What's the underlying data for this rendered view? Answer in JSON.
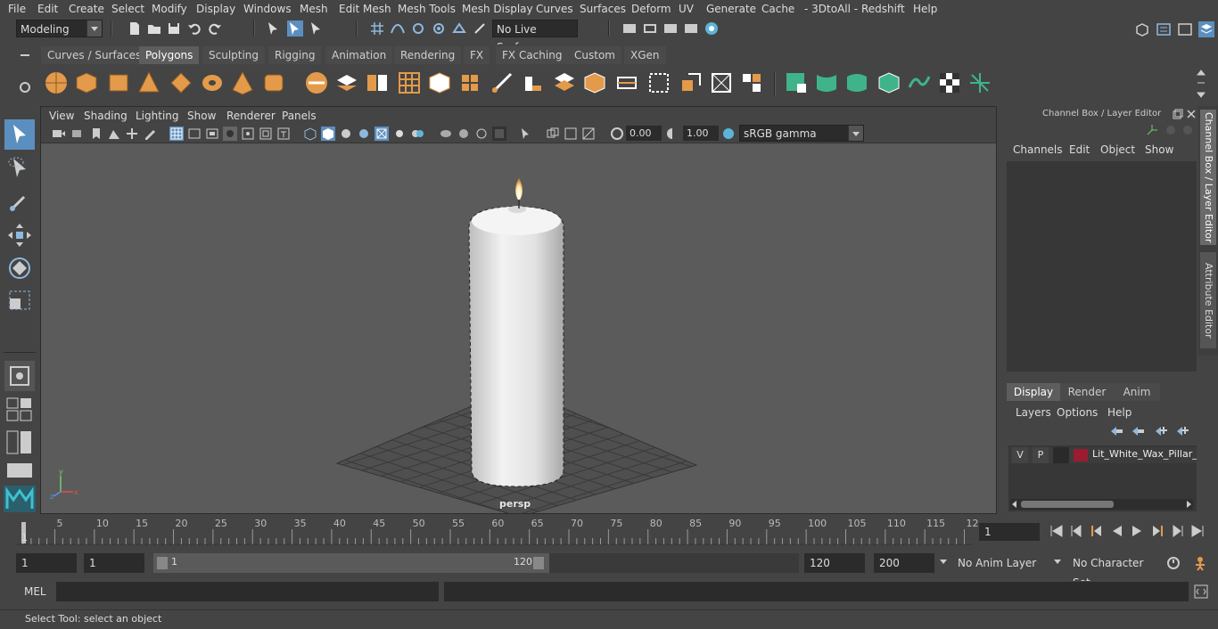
{
  "menu": [
    "File",
    "Edit",
    "Create",
    "Select",
    "Modify",
    "Display",
    "Windows",
    "Mesh",
    "Edit Mesh",
    "Mesh Tools",
    "Mesh Display",
    "Curves",
    "Surfaces",
    "Deform",
    "UV",
    "Generate",
    "Cache",
    "- 3DtoAll -",
    "Redshift",
    "Help"
  ],
  "status": {
    "workspace": "Modeling",
    "live_surface": "No Live Surface"
  },
  "shelf_tabs": [
    "Curves / Surfaces",
    "Polygons",
    "Sculpting",
    "Rigging",
    "Animation",
    "Rendering",
    "FX",
    "FX Caching",
    "Custom",
    "XGen"
  ],
  "active_shelf_tab": "Polygons",
  "viewport": {
    "menu": [
      "View",
      "Shading",
      "Lighting",
      "Show",
      "Renderer",
      "Panels"
    ],
    "exposure": "0.00",
    "gamma": "1.00",
    "color_space": "sRGB gamma",
    "camera_label": "persp"
  },
  "channel_box": {
    "title": "Channel Box / Layer Editor",
    "menu": [
      "Channels",
      "Edit",
      "Object",
      "Show"
    ]
  },
  "layer_editor": {
    "tabs": [
      "Display",
      "Render",
      "Anim"
    ],
    "active_tab": "Display",
    "menu": [
      "Layers",
      "Options",
      "Help"
    ],
    "layer": {
      "v": "V",
      "p": "P",
      "name": "Lit_White_Wax_Pillar_C",
      "color": "#9b1b30"
    }
  },
  "side_tabs": [
    "Channel Box / Layer Editor",
    "Attribute Editor"
  ],
  "timeline": {
    "ticks": [
      "5",
      "10",
      "15",
      "20",
      "25",
      "30",
      "35",
      "40",
      "45",
      "50",
      "55",
      "60",
      "65",
      "70",
      "75",
      "80",
      "85",
      "90",
      "95",
      "100",
      "105",
      "110",
      "115",
      "12"
    ],
    "current_frame_marker": "1",
    "current_frame_field": "1"
  },
  "range": {
    "start": "1",
    "playback_start": "1",
    "slider_start": "1",
    "slider_end": "120",
    "playback_end": "120",
    "end": "200",
    "anim_layer": "No Anim Layer",
    "character_set": "No Character Set"
  },
  "cmdline": {
    "lang": "MEL"
  },
  "help_line": "Select Tool: select an object",
  "colors": {
    "accent": "#5b8fbf",
    "shelf_orange": "#e39a4a",
    "shelf_green": "#3fb48a"
  }
}
